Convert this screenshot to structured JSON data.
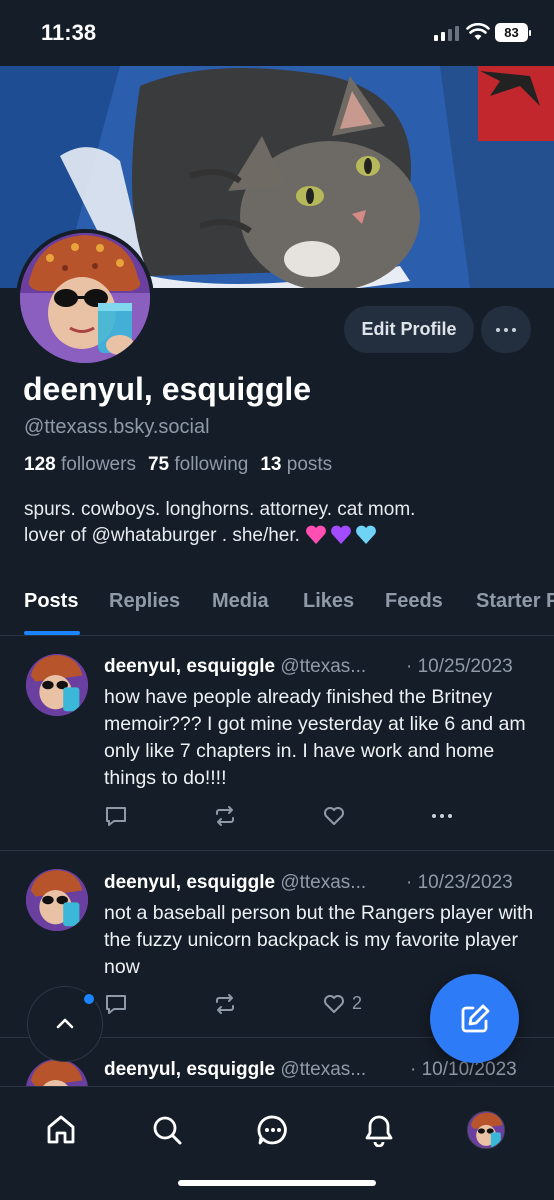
{
  "status_bar": {
    "time": "11:38",
    "battery": "83"
  },
  "profile": {
    "display_name": "deenyul, esquiggle",
    "handle": "@ttexass.bsky.social",
    "followers_count": "128",
    "followers_label": "followers",
    "following_count": "75",
    "following_label": "following",
    "posts_count": "13",
    "posts_label": "posts",
    "bio_line1": "spurs. cowboys. longhorns. attorney. cat mom.",
    "bio_line2": "lover of @whataburger . she/her.",
    "edit_label": "Edit Profile"
  },
  "tabs": [
    {
      "label": "Posts",
      "active": true
    },
    {
      "label": "Replies"
    },
    {
      "label": "Media"
    },
    {
      "label": "Likes"
    },
    {
      "label": "Feeds"
    },
    {
      "label": "Starter Packs"
    }
  ],
  "posts": [
    {
      "author": "deenyul, esquiggle",
      "handle": "@ttexas...",
      "date": "· 10/25/2023",
      "text": "how have people already finished the Britney memoir??? I got mine yesterday at like 6 and am only like 7 chapters in. I have work and home things to do!!!!",
      "like_count": ""
    },
    {
      "author": "deenyul, esquiggle",
      "handle": "@ttexas...",
      "date": "· 10/23/2023",
      "text": "not a baseball person but the Rangers player with the fuzzy unicorn backpack is my favorite player now",
      "like_count": "2"
    },
    {
      "author": "deenyul, esquiggle",
      "handle": "@ttexas...",
      "date": "· 10/10/2023"
    }
  ],
  "nav": [
    "home-icon",
    "search-icon",
    "chat-icon",
    "bell-icon",
    "profile-avatar"
  ],
  "colors": {
    "background": "#151d28",
    "accent": "#1a85ff",
    "fab": "#2d7bf6",
    "muted_text": "#8f9aa8"
  }
}
